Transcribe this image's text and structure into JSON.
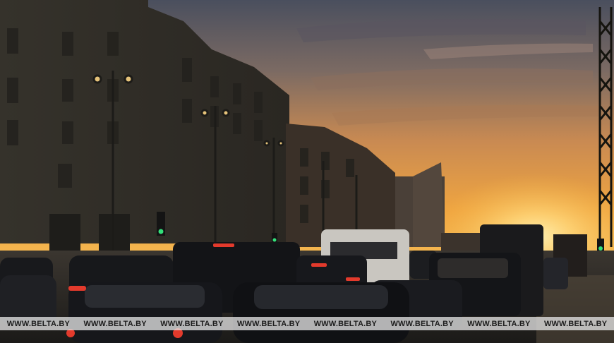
{
  "photo": {
    "subject": "city-street-traffic-at-sunset",
    "colors": {
      "sky_top": "#4a4f5e",
      "sky_mid": "#c98a52",
      "sky_glow": "#f3b446",
      "sun": "#ffd77a",
      "building": "#2d2b26",
      "car": "#15161a",
      "tail_light": "#e33a2c",
      "traffic_light": "#33e07a"
    }
  },
  "watermark": {
    "items": [
      "WWW.BELTA.BY",
      "WWW.BELTA.BY",
      "WWW.BELTA.BY",
      "WWW.BELTA.BY",
      "WWW.BELTA.BY",
      "WWW.BELTA.BY",
      "WWW.BELTA.BY",
      "WWW.BELTA.BY"
    ]
  }
}
